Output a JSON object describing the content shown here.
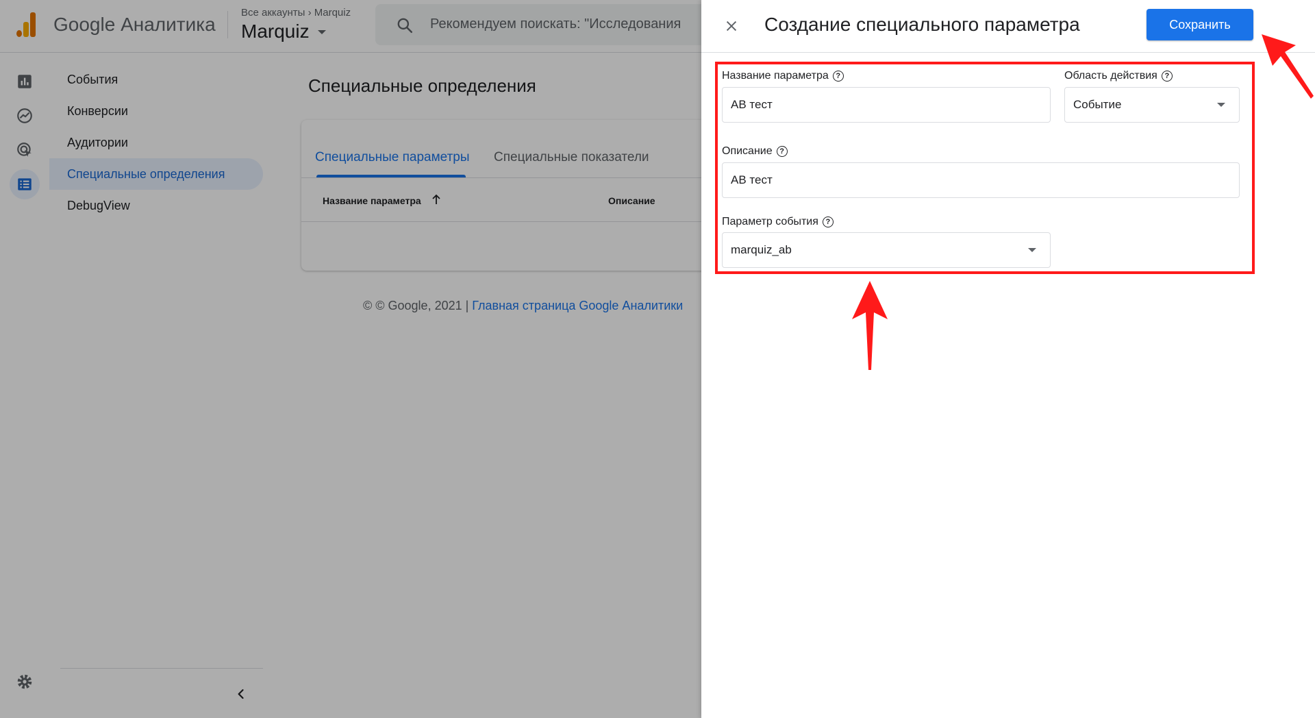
{
  "header": {
    "product_name": "Google Аналитика",
    "breadcrumb": "Все аккаунты  ›  Marquiz",
    "account_name": "Marquiz",
    "search_placeholder": "Рекомендуем поискать: \"Исследования"
  },
  "subnav": {
    "items": [
      {
        "label": "События"
      },
      {
        "label": "Конверсии"
      },
      {
        "label": "Аудитории"
      },
      {
        "label": "Специальные определения",
        "active": true
      },
      {
        "label": "DebugView"
      }
    ]
  },
  "main": {
    "page_title": "Специальные определения",
    "tabs": [
      {
        "label": "Специальные параметры",
        "active": true
      },
      {
        "label": "Специальные показатели"
      }
    ],
    "table_headers": [
      "Название параметра",
      "Описание"
    ],
    "footer_copyright": "© © Google, 2021 | ",
    "footer_link": "Главная страница Google Аналитики"
  },
  "panel": {
    "title": "Создание специального параметра",
    "save_label": "Сохранить",
    "fields": {
      "param_name": {
        "label": "Название параметра",
        "value": "AB тест"
      },
      "scope": {
        "label": "Область действия",
        "value": "Событие"
      },
      "description": {
        "label": "Описание",
        "value": "AB тест"
      },
      "event_param": {
        "label": "Параметр события",
        "value": "marquiz_ab"
      }
    }
  },
  "colors": {
    "accent": "#1a73e8",
    "annotation_red": "#ff1a1a",
    "active_nav_bg": "#e8f0fe"
  },
  "icons": [
    "analytics-logo-icon",
    "search-icon",
    "reports-icon",
    "explore-icon",
    "advertising-icon",
    "configure-icon",
    "settings-icon",
    "chevron-left-icon",
    "close-icon",
    "help-icon",
    "arrow-up-icon",
    "dropdown-caret-icon"
  ]
}
